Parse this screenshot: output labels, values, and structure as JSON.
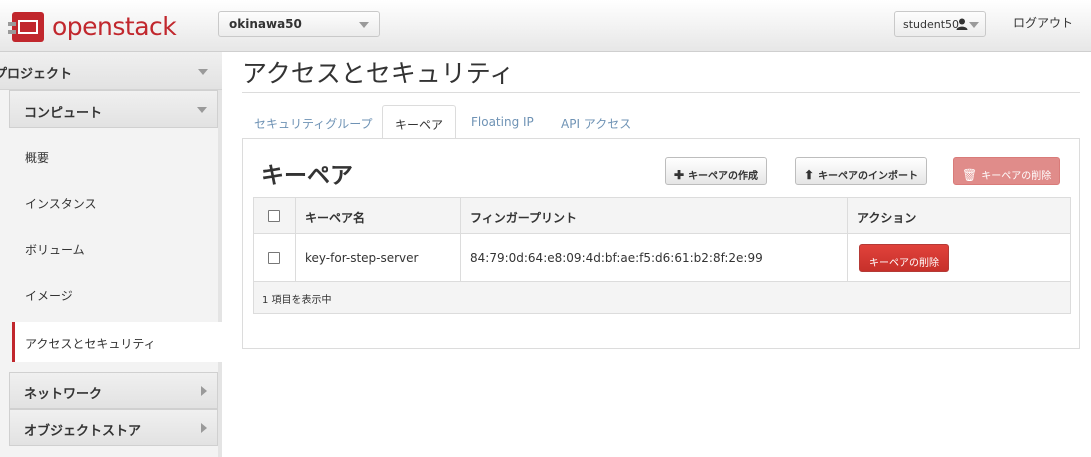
{
  "header": {
    "logo_text": "openstack",
    "project": "okinawa50",
    "user": "student50",
    "logout": "ログアウト"
  },
  "sidebar": {
    "project_label": "プロジェクト",
    "compute_label": "コンピュート",
    "items": [
      {
        "label": "概要"
      },
      {
        "label": "インスタンス"
      },
      {
        "label": "ボリューム"
      },
      {
        "label": "イメージ"
      },
      {
        "label": "アクセスとセキュリティ",
        "active": true
      }
    ],
    "sections": [
      {
        "label": "ネットワーク"
      },
      {
        "label": "オブジェクトストア"
      }
    ]
  },
  "main": {
    "title": "アクセスとセキュリティ",
    "tabs": [
      {
        "label": "セキュリティグループ"
      },
      {
        "label": "キーペア",
        "active": true
      },
      {
        "label": "Floating IP"
      },
      {
        "label": "API アクセス"
      }
    ],
    "panel": {
      "title": "キーペア",
      "create_button": "キーペアの作成",
      "import_button": "キーペアのインポート",
      "delete_button": "キーペアの削除"
    },
    "table": {
      "columns": [
        "キーペア名",
        "フィンガープリント",
        "アクション"
      ],
      "rows": [
        {
          "name": "key-for-step-server",
          "fingerprint": "84:79:0d:64:e8:09:4d:bf:ae:f5:d6:61:b2:8f:2e:99",
          "action": "キーペアの削除"
        }
      ],
      "footer": "1 項目を表示中"
    }
  },
  "colors": {
    "brand_red": "#c1272d",
    "link_blue": "#6f93b5",
    "danger_button": "#d0342e"
  },
  "icons": {
    "logo": "openstack-logo-icon",
    "user": "person-icon",
    "create": "plus-icon",
    "import": "arrow-up-icon",
    "delete": "trash-icon"
  }
}
